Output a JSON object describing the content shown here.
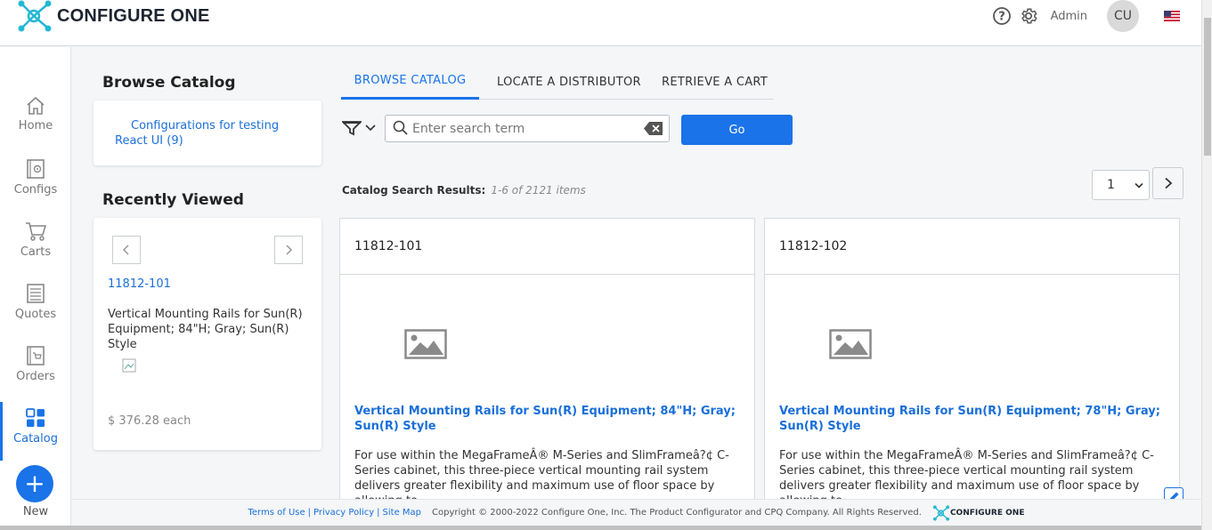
{
  "header": {
    "brand": "CONFIGURE ONE",
    "user_label": "Admin",
    "avatar_initials": "CU"
  },
  "nav": {
    "items": [
      {
        "label": "Home",
        "icon": "home-icon"
      },
      {
        "label": "Configs",
        "icon": "configs-icon"
      },
      {
        "label": "Carts",
        "icon": "cart-icon"
      },
      {
        "label": "Quotes",
        "icon": "quotes-icon"
      },
      {
        "label": "Orders",
        "icon": "orders-icon"
      },
      {
        "label": "Catalog",
        "icon": "catalog-icon"
      }
    ],
    "new_label": "New",
    "new_symbol": "+"
  },
  "browse": {
    "title": "Browse Catalog",
    "link": "Configurations for testing React UI (9)"
  },
  "recent": {
    "title": "Recently Viewed",
    "item_id": "11812-101",
    "item_desc": "Vertical Mounting Rails for Sun(R) Equipment; 84\"H; Gray; Sun(R) Style",
    "price": "$ 376.28 each"
  },
  "tabs": [
    {
      "label": "BROWSE CATALOG",
      "active": true
    },
    {
      "label": "LOCATE A DISTRIBUTOR",
      "active": false
    },
    {
      "label": "RETRIEVE A CART",
      "active": false
    }
  ],
  "search": {
    "placeholder": "Enter search term",
    "value": "",
    "go_label": "Go"
  },
  "results": {
    "label": "Catalog Search Results:",
    "count": "1-6 of 2121 items",
    "page": "1"
  },
  "products": [
    {
      "id": "11812-101",
      "title": "Vertical Mounting Rails for Sun(R) Equipment; 84\"H; Gray; Sun(R) Style",
      "desc": "For use within the MegaFrameÂ® M-Series and SlimFrameâ?¢ C-Series cabinet, this three-piece vertical mounting rail system delivers greater flexibility and maximum use of floor space by allowing to..."
    },
    {
      "id": "11812-102",
      "title": "Vertical Mounting Rails for Sun(R) Equipment; 78\"H; Gray; Sun(R) Style",
      "desc": "For use within the MegaFrameÂ® M-Series and SlimFrameâ?¢ C-Series cabinet, this three-piece vertical mounting rail system delivers greater flexibility and maximum use of floor space by allowing to..."
    }
  ],
  "footer": {
    "terms": "Terms of Use",
    "privacy": "Privacy Policy",
    "sitemap": "Site Map",
    "sep": "|",
    "copyright": "Copyright © 2000-2022 Configure One, Inc. The Product Configurator and CPQ Company. All Rights Reserved.",
    "brand": "CONFIGURE ONE"
  },
  "colors": {
    "accent": "#1a73e8",
    "link": "#1a6fd9",
    "logo_teal": "#26b7d4"
  }
}
